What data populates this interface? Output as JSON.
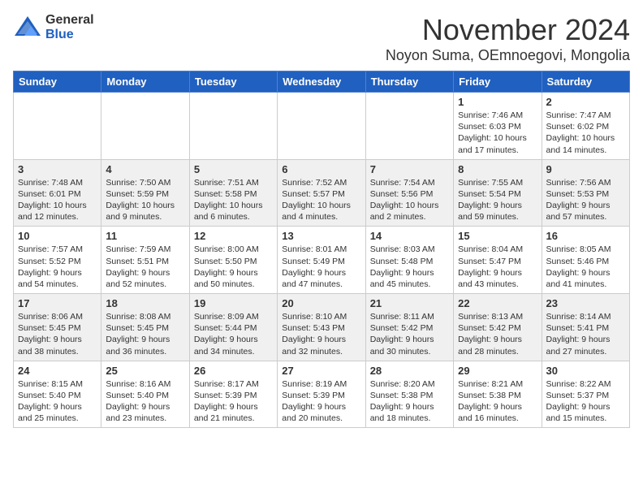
{
  "logo": {
    "text_general": "General",
    "text_blue": "Blue"
  },
  "title": {
    "month": "November 2024",
    "location": "Noyon Suma, OEmnoegovi, Mongolia"
  },
  "weekdays": [
    "Sunday",
    "Monday",
    "Tuesday",
    "Wednesday",
    "Thursday",
    "Friday",
    "Saturday"
  ],
  "weeks": [
    [
      {
        "day": "",
        "info": ""
      },
      {
        "day": "",
        "info": ""
      },
      {
        "day": "",
        "info": ""
      },
      {
        "day": "",
        "info": ""
      },
      {
        "day": "",
        "info": ""
      },
      {
        "day": "1",
        "info": "Sunrise: 7:46 AM\nSunset: 6:03 PM\nDaylight: 10 hours\nand 17 minutes."
      },
      {
        "day": "2",
        "info": "Sunrise: 7:47 AM\nSunset: 6:02 PM\nDaylight: 10 hours\nand 14 minutes."
      }
    ],
    [
      {
        "day": "3",
        "info": "Sunrise: 7:48 AM\nSunset: 6:01 PM\nDaylight: 10 hours\nand 12 minutes."
      },
      {
        "day": "4",
        "info": "Sunrise: 7:50 AM\nSunset: 5:59 PM\nDaylight: 10 hours\nand 9 minutes."
      },
      {
        "day": "5",
        "info": "Sunrise: 7:51 AM\nSunset: 5:58 PM\nDaylight: 10 hours\nand 6 minutes."
      },
      {
        "day": "6",
        "info": "Sunrise: 7:52 AM\nSunset: 5:57 PM\nDaylight: 10 hours\nand 4 minutes."
      },
      {
        "day": "7",
        "info": "Sunrise: 7:54 AM\nSunset: 5:56 PM\nDaylight: 10 hours\nand 2 minutes."
      },
      {
        "day": "8",
        "info": "Sunrise: 7:55 AM\nSunset: 5:54 PM\nDaylight: 9 hours\nand 59 minutes."
      },
      {
        "day": "9",
        "info": "Sunrise: 7:56 AM\nSunset: 5:53 PM\nDaylight: 9 hours\nand 57 minutes."
      }
    ],
    [
      {
        "day": "10",
        "info": "Sunrise: 7:57 AM\nSunset: 5:52 PM\nDaylight: 9 hours\nand 54 minutes."
      },
      {
        "day": "11",
        "info": "Sunrise: 7:59 AM\nSunset: 5:51 PM\nDaylight: 9 hours\nand 52 minutes."
      },
      {
        "day": "12",
        "info": "Sunrise: 8:00 AM\nSunset: 5:50 PM\nDaylight: 9 hours\nand 50 minutes."
      },
      {
        "day": "13",
        "info": "Sunrise: 8:01 AM\nSunset: 5:49 PM\nDaylight: 9 hours\nand 47 minutes."
      },
      {
        "day": "14",
        "info": "Sunrise: 8:03 AM\nSunset: 5:48 PM\nDaylight: 9 hours\nand 45 minutes."
      },
      {
        "day": "15",
        "info": "Sunrise: 8:04 AM\nSunset: 5:47 PM\nDaylight: 9 hours\nand 43 minutes."
      },
      {
        "day": "16",
        "info": "Sunrise: 8:05 AM\nSunset: 5:46 PM\nDaylight: 9 hours\nand 41 minutes."
      }
    ],
    [
      {
        "day": "17",
        "info": "Sunrise: 8:06 AM\nSunset: 5:45 PM\nDaylight: 9 hours\nand 38 minutes."
      },
      {
        "day": "18",
        "info": "Sunrise: 8:08 AM\nSunset: 5:45 PM\nDaylight: 9 hours\nand 36 minutes."
      },
      {
        "day": "19",
        "info": "Sunrise: 8:09 AM\nSunset: 5:44 PM\nDaylight: 9 hours\nand 34 minutes."
      },
      {
        "day": "20",
        "info": "Sunrise: 8:10 AM\nSunset: 5:43 PM\nDaylight: 9 hours\nand 32 minutes."
      },
      {
        "day": "21",
        "info": "Sunrise: 8:11 AM\nSunset: 5:42 PM\nDaylight: 9 hours\nand 30 minutes."
      },
      {
        "day": "22",
        "info": "Sunrise: 8:13 AM\nSunset: 5:42 PM\nDaylight: 9 hours\nand 28 minutes."
      },
      {
        "day": "23",
        "info": "Sunrise: 8:14 AM\nSunset: 5:41 PM\nDaylight: 9 hours\nand 27 minutes."
      }
    ],
    [
      {
        "day": "24",
        "info": "Sunrise: 8:15 AM\nSunset: 5:40 PM\nDaylight: 9 hours\nand 25 minutes."
      },
      {
        "day": "25",
        "info": "Sunrise: 8:16 AM\nSunset: 5:40 PM\nDaylight: 9 hours\nand 23 minutes."
      },
      {
        "day": "26",
        "info": "Sunrise: 8:17 AM\nSunset: 5:39 PM\nDaylight: 9 hours\nand 21 minutes."
      },
      {
        "day": "27",
        "info": "Sunrise: 8:19 AM\nSunset: 5:39 PM\nDaylight: 9 hours\nand 20 minutes."
      },
      {
        "day": "28",
        "info": "Sunrise: 8:20 AM\nSunset: 5:38 PM\nDaylight: 9 hours\nand 18 minutes."
      },
      {
        "day": "29",
        "info": "Sunrise: 8:21 AM\nSunset: 5:38 PM\nDaylight: 9 hours\nand 16 minutes."
      },
      {
        "day": "30",
        "info": "Sunrise: 8:22 AM\nSunset: 5:37 PM\nDaylight: 9 hours\nand 15 minutes."
      }
    ]
  ]
}
